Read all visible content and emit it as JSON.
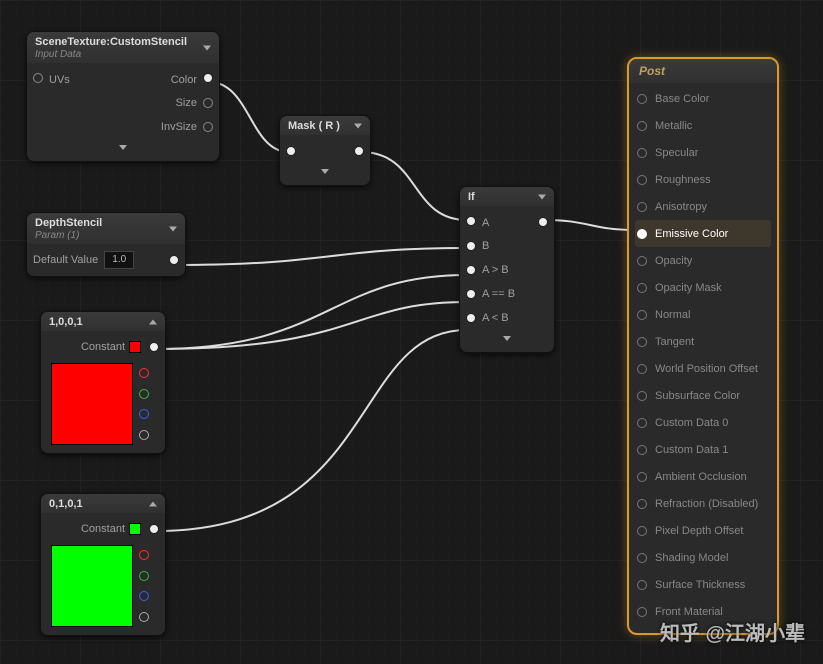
{
  "nodes": {
    "sceneTexture": {
      "title": "SceneTexture:CustomStencil",
      "subtitle": "Input Data",
      "inputs": {
        "uvs": "UVs"
      },
      "outputs": {
        "color": "Color",
        "size": "Size",
        "invSize": "InvSize"
      }
    },
    "depthStencil": {
      "title": "DepthStencil",
      "subtitle": "Param (1)",
      "defaultLabel": "Default Value",
      "defaultValue": "1.0"
    },
    "mask": {
      "title": "Mask ( R )"
    },
    "ifNode": {
      "title": "If",
      "inputs": {
        "a": "A",
        "b": "B",
        "aGtB": "A > B",
        "aEqB": "A == B",
        "aLtB": "A < B"
      }
    },
    "constRed": {
      "title": "1,0,0,1",
      "label": "Constant",
      "swatch": "#ff0000"
    },
    "constGreen": {
      "title": "0,1,0,1",
      "label": "Constant",
      "swatch": "#00ff00"
    }
  },
  "post": {
    "title": "Post",
    "items": [
      "Base Color",
      "Metallic",
      "Specular",
      "Roughness",
      "Anisotropy",
      "Emissive Color",
      "Opacity",
      "Opacity Mask",
      "Normal",
      "Tangent",
      "World Position Offset",
      "Subsurface Color",
      "Custom Data 0",
      "Custom Data 1",
      "Ambient Occlusion",
      "Refraction (Disabled)",
      "Pixel Depth Offset",
      "Shading Model",
      "Surface Thickness",
      "Front Material"
    ],
    "activeIndex": 5
  },
  "watermark": "知乎 @江湖小辈"
}
